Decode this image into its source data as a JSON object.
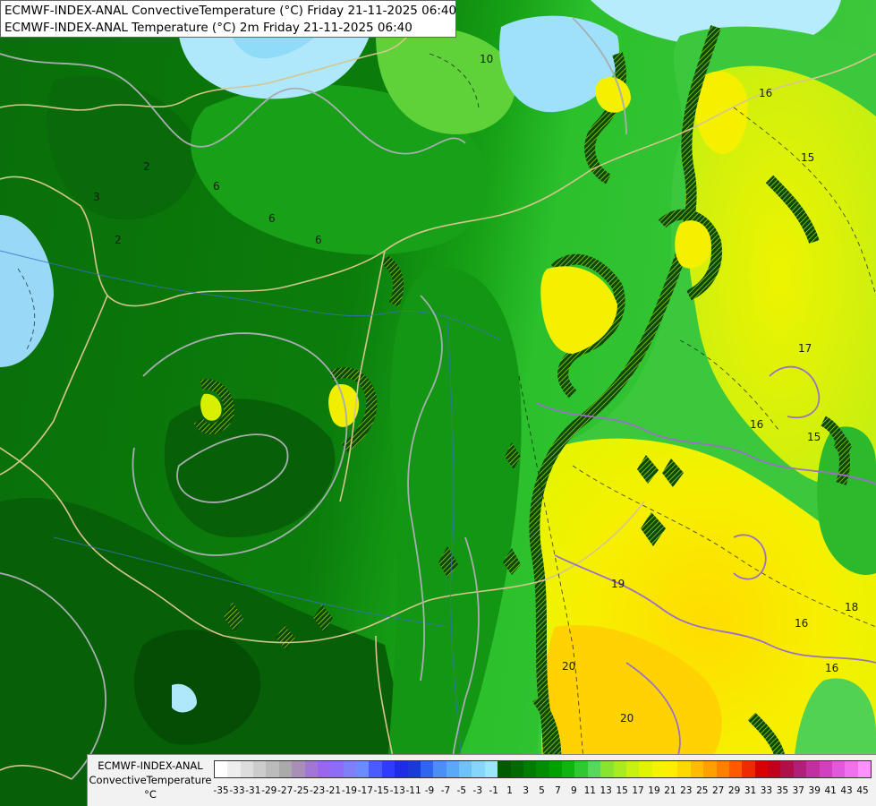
{
  "header": {
    "line1": "ECMWF-INDEX-ANAL ConvectiveTemperature (°C) Friday 21-11-2025 06:40",
    "line2": "ECMWF-INDEX-ANAL Temperature (°C) 2m Friday 21-11-2025 06:40"
  },
  "legend": {
    "title_line1": "ECMWF-INDEX-ANAL",
    "title_line2": "ConvectiveTemperature",
    "unit": "°C",
    "ticks": [
      "-35",
      "-33",
      "-31",
      "-29",
      "-27",
      "-25",
      "-23",
      "-21",
      "-19",
      "-17",
      "-15",
      "-13",
      "-11",
      "-9",
      "-7",
      "-5",
      "-3",
      "-1",
      "1",
      "3",
      "5",
      "7",
      "9",
      "11",
      "13",
      "15",
      "17",
      "19",
      "21",
      "23",
      "25",
      "27",
      "29",
      "31",
      "33",
      "35",
      "37",
      "39",
      "41",
      "43",
      "45"
    ],
    "colors": [
      "#ffffff",
      "#eeeeee",
      "#dddddd",
      "#cccccc",
      "#bbbbbb",
      "#aaaaaa",
      "#a98fb8",
      "#a077d6",
      "#9a66ee",
      "#8f6cf5",
      "#7f7ff8",
      "#6b8cff",
      "#4a5cff",
      "#2f3cff",
      "#1f2ce6",
      "#1a3ad8",
      "#2f66f0",
      "#4a8ef6",
      "#5aa8f8",
      "#6ec2fa",
      "#85d6fb",
      "#9ae6fc",
      "#005a00",
      "#006a00",
      "#007c00",
      "#008e00",
      "#00a000",
      "#10b410",
      "#30c830",
      "#58d858",
      "#88e430",
      "#a8ec20",
      "#c8f010",
      "#e0f400",
      "#f4f400",
      "#ffee00",
      "#ffd800",
      "#ffbc00",
      "#ffa000",
      "#ff8000",
      "#ff5a00",
      "#f02a00",
      "#d80000",
      "#c0001a",
      "#b0104a",
      "#b0207a",
      "#c030a0",
      "#d040c0",
      "#e058dc",
      "#f070f0",
      "#ff90ff"
    ]
  },
  "map": {
    "contour_labels": [
      "16",
      "15",
      "17",
      "16",
      "15",
      "16",
      "19",
      "20",
      "20",
      "18",
      "16",
      "2",
      "2",
      "3",
      "6",
      "6",
      "6",
      "10"
    ]
  }
}
